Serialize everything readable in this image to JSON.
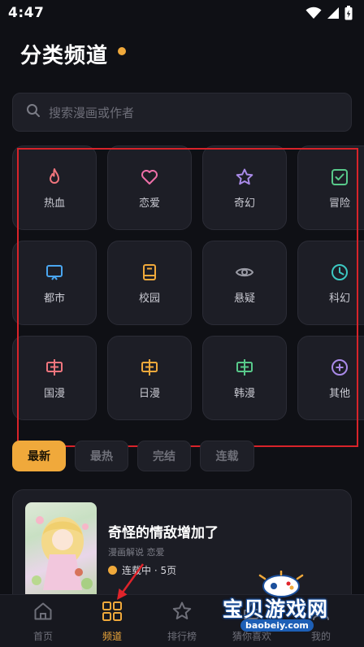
{
  "status_bar": {
    "time": "4:47",
    "icons": [
      "wifi-icon",
      "signal-icon",
      "battery-charging-icon"
    ]
  },
  "header": {
    "title": "分类频道"
  },
  "search": {
    "placeholder": "搜索漫画或作者"
  },
  "categories": [
    {
      "label": "热血",
      "icon": "flame-icon",
      "color": "#f0757d"
    },
    {
      "label": "恋爱",
      "icon": "heart-icon",
      "color": "#ee6fa8"
    },
    {
      "label": "奇幻",
      "icon": "star-icon",
      "color": "#a98ae8"
    },
    {
      "label": "冒险",
      "icon": "checkbox-icon",
      "color": "#58c98a"
    },
    {
      "label": "都市",
      "icon": "monitor-icon",
      "color": "#4aa6f0"
    },
    {
      "label": "校园",
      "icon": "book-icon",
      "color": "#f0a93b"
    },
    {
      "label": "悬疑",
      "icon": "eye-icon",
      "color": "#9a9ba5"
    },
    {
      "label": "科幻",
      "icon": "clock-icon",
      "color": "#3cc8c2"
    },
    {
      "label": "国漫",
      "icon": "banner-icon",
      "color": "#f0757d"
    },
    {
      "label": "日漫",
      "icon": "banner-icon",
      "color": "#f0a93b"
    },
    {
      "label": "韩漫",
      "icon": "banner-icon",
      "color": "#58c98a"
    },
    {
      "label": "其他",
      "icon": "plus-circle-icon",
      "color": "#a98ae8"
    }
  ],
  "filter_tabs": [
    {
      "label": "最新",
      "active": true
    },
    {
      "label": "最热",
      "active": false
    },
    {
      "label": "完结",
      "active": false
    },
    {
      "label": "连载",
      "active": false
    }
  ],
  "comic_card": {
    "title": "奇怪的情敌增加了",
    "tags": "漫画解说 恋爱",
    "status": "连载中 · 5页"
  },
  "bottom_nav": [
    {
      "label": "首页",
      "icon": "home-icon",
      "active": false
    },
    {
      "label": "频道",
      "icon": "grid-icon",
      "active": true
    },
    {
      "label": "排行榜",
      "icon": "star-icon",
      "active": false
    },
    {
      "label": "猜你喜欢",
      "icon": "thumb-icon",
      "active": false
    },
    {
      "label": "我的",
      "icon": "user-icon",
      "active": false
    }
  ],
  "watermark": {
    "text": "宝贝游戏网",
    "url": "baobeiy.com"
  },
  "colors": {
    "accent": "#f0a93b",
    "background": "#0f1015",
    "card": "#1d1e26",
    "highlight": "#d8232a"
  }
}
